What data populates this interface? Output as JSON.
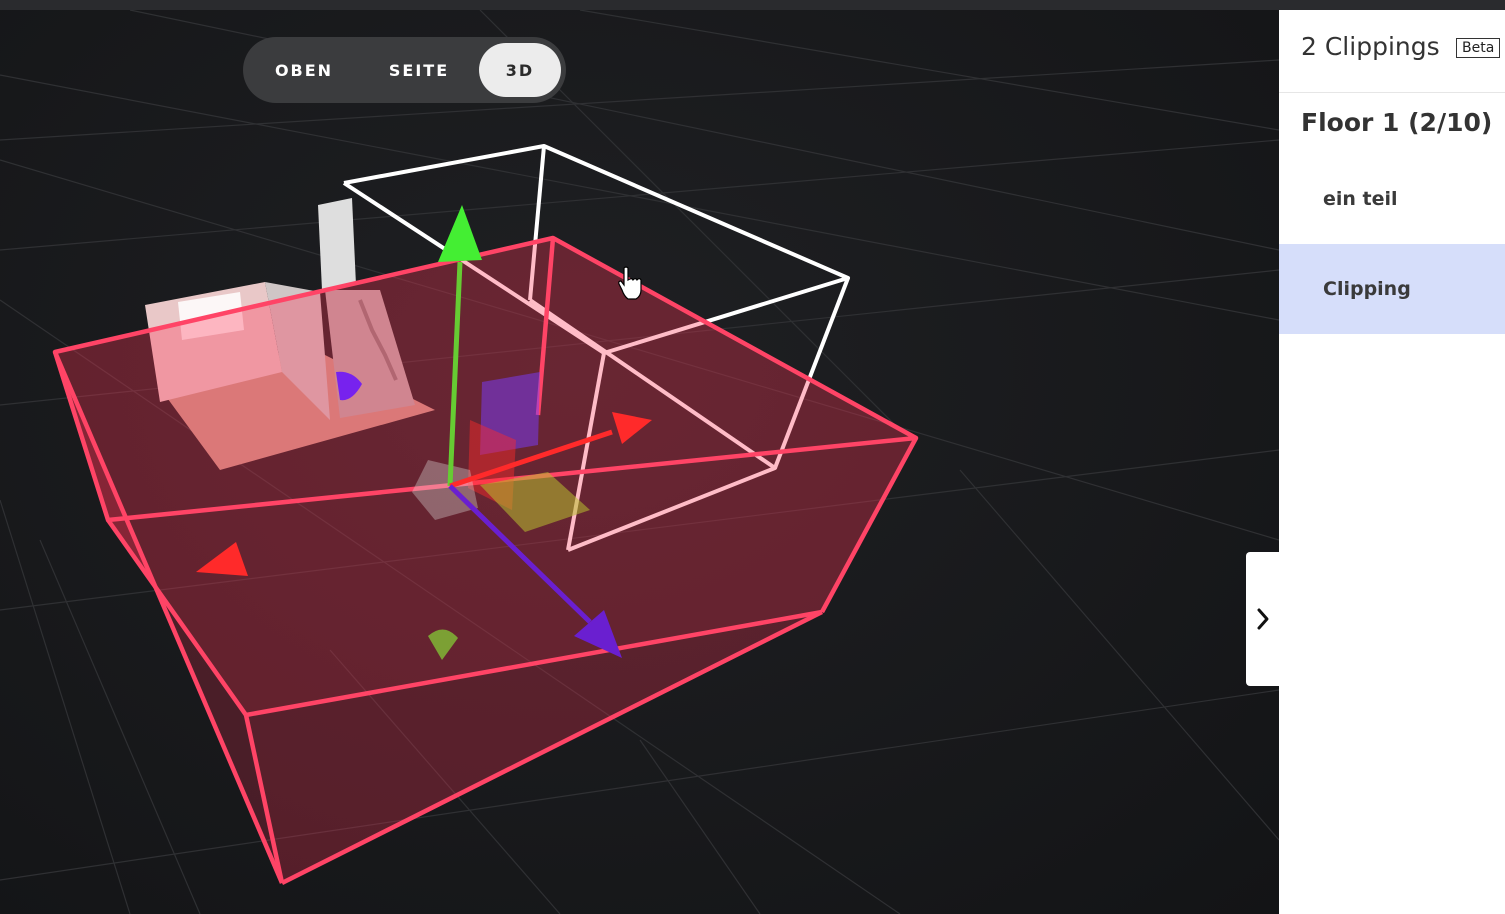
{
  "view_toggle": {
    "buttons": [
      {
        "label": "OBEN",
        "active": false
      },
      {
        "label": "SEITE",
        "active": false
      },
      {
        "label": "3D",
        "active": true
      }
    ]
  },
  "panel": {
    "title": "2 Clippings",
    "badge": "Beta",
    "floor_title": "Floor 1 (2/10)",
    "items": [
      {
        "label": "ein teil",
        "selected": false
      },
      {
        "label": "Clipping",
        "selected": true
      }
    ]
  },
  "colors": {
    "selected_clipping": "#ff4466",
    "unselected_clipping": "#ffffff",
    "axis_x": "#ff2a2a",
    "axis_y": "#44ee33",
    "axis_z": "#6a1fd0",
    "selection_highlight": "#d6defa"
  },
  "icons": {
    "collapse": "chevron-right-icon",
    "cursor": "hand-pointer-icon"
  }
}
